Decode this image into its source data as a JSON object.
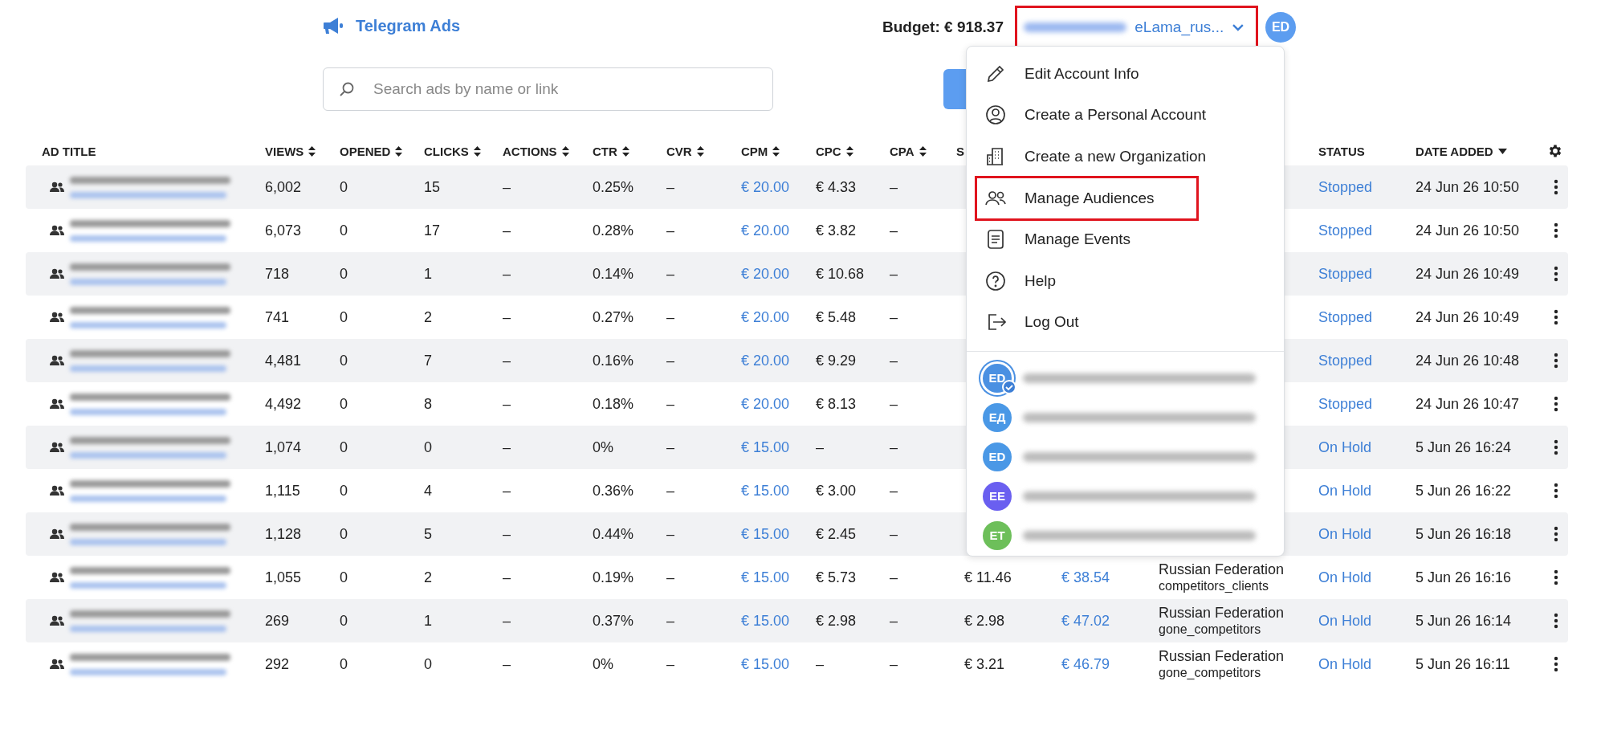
{
  "header": {
    "app_name": "Telegram Ads",
    "budget": "Budget: € 918.37",
    "account": "eLama_rus...",
    "avatar": "ED"
  },
  "search": {
    "placeholder": "Search ads by name or link"
  },
  "table": {
    "columns": [
      {
        "label": "AD TITLE",
        "kind": "plain"
      },
      {
        "label": "VIEWS",
        "kind": "sortable"
      },
      {
        "label": "OPENED",
        "kind": "sortable"
      },
      {
        "label": "CLICKS",
        "kind": "sortable"
      },
      {
        "label": "ACTIONS",
        "kind": "sortable"
      },
      {
        "label": "CTR",
        "kind": "sortable"
      },
      {
        "label": "CVR",
        "kind": "sortable"
      },
      {
        "label": "CPM",
        "kind": "sortable"
      },
      {
        "label": "CPC",
        "kind": "sortable"
      },
      {
        "label": "CPA",
        "kind": "sortable"
      },
      {
        "label": "S",
        "kind": "plain"
      },
      {
        "label": "STATUS",
        "kind": "plain"
      },
      {
        "label": "DATE ADDED",
        "kind": "sorted_desc"
      }
    ],
    "rows": [
      {
        "views": "6,002",
        "opened": "0",
        "clicks": "15",
        "actions": "–",
        "ctr": "0.25%",
        "cvr": "–",
        "cpm": "€ 20.00",
        "cpc": "€ 4.33",
        "cpa": "–",
        "status": "Stopped",
        "date": "24 Jun 26 10:50"
      },
      {
        "views": "6,073",
        "opened": "0",
        "clicks": "17",
        "actions": "–",
        "ctr": "0.28%",
        "cvr": "–",
        "cpm": "€ 20.00",
        "cpc": "€ 3.82",
        "cpa": "–",
        "status": "Stopped",
        "date": "24 Jun 26 10:50"
      },
      {
        "views": "718",
        "opened": "0",
        "clicks": "1",
        "actions": "–",
        "ctr": "0.14%",
        "cvr": "–",
        "cpm": "€ 20.00",
        "cpc": "€ 10.68",
        "cpa": "–",
        "status": "Stopped",
        "date": "24 Jun 26 10:49"
      },
      {
        "views": "741",
        "opened": "0",
        "clicks": "2",
        "actions": "–",
        "ctr": "0.27%",
        "cvr": "–",
        "cpm": "€ 20.00",
        "cpc": "€ 5.48",
        "cpa": "–",
        "status": "Stopped",
        "date": "24 Jun 26 10:49"
      },
      {
        "views": "4,481",
        "opened": "0",
        "clicks": "7",
        "actions": "–",
        "ctr": "0.16%",
        "cvr": "–",
        "cpm": "€ 20.00",
        "cpc": "€ 9.29",
        "cpa": "–",
        "status": "Stopped",
        "date": "24 Jun 26 10:48"
      },
      {
        "views": "4,492",
        "opened": "0",
        "clicks": "8",
        "actions": "–",
        "ctr": "0.18%",
        "cvr": "–",
        "cpm": "€ 20.00",
        "cpc": "€ 8.13",
        "cpa": "–",
        "status": "Stopped",
        "date": "24 Jun 26 10:47"
      },
      {
        "views": "1,074",
        "opened": "0",
        "clicks": "0",
        "actions": "–",
        "ctr": "0%",
        "cvr": "–",
        "cpm": "€ 15.00",
        "cpc": "–",
        "cpa": "–",
        "status": "On Hold",
        "date": "5 Jun 26 16:24"
      },
      {
        "views": "1,115",
        "opened": "0",
        "clicks": "4",
        "actions": "–",
        "ctr": "0.36%",
        "cvr": "–",
        "cpm": "€ 15.00",
        "cpc": "€ 3.00",
        "cpa": "–",
        "status": "On Hold",
        "date": "5 Jun 26 16:22"
      },
      {
        "views": "1,128",
        "opened": "0",
        "clicks": "5",
        "actions": "–",
        "ctr": "0.44%",
        "cvr": "–",
        "cpm": "€ 15.00",
        "cpc": "€ 2.45",
        "cpa": "–",
        "status": "On Hold",
        "date": "5 Jun 26 16:18"
      },
      {
        "views": "1,055",
        "opened": "0",
        "clicks": "2",
        "actions": "–",
        "ctr": "0.19%",
        "cvr": "–",
        "cpm": "€ 15.00",
        "cpc": "€ 5.73",
        "cpa": "–",
        "spent": "€ 11.46",
        "column_12": "€ 38.54",
        "region": "Russian Federation",
        "audience": "competitors_clients",
        "status": "On Hold",
        "date": "5 Jun 26 16:16"
      },
      {
        "views": "269",
        "opened": "0",
        "clicks": "1",
        "actions": "–",
        "ctr": "0.37%",
        "cvr": "–",
        "cpm": "€ 15.00",
        "cpc": "€ 2.98",
        "cpa": "–",
        "spent": "€ 2.98",
        "column_12": "€ 47.02",
        "region": "Russian Federation",
        "audience": "gone_competitors",
        "status": "On Hold",
        "date": "5 Jun 26 16:14"
      },
      {
        "views": "292",
        "opened": "0",
        "clicks": "0",
        "actions": "–",
        "ctr": "0%",
        "cvr": "–",
        "cpm": "€ 15.00",
        "cpc": "–",
        "cpa": "–",
        "spent": "€ 3.21",
        "column_12": "€ 46.79",
        "region": "Russian Federation",
        "audience": "gone_competitors",
        "status": "On Hold",
        "date": "5 Jun 26 16:11"
      }
    ]
  },
  "account_menu": {
    "items": [
      {
        "label": "Edit Account Info",
        "kind": "pencil"
      },
      {
        "label": "Create a Personal Account",
        "kind": "person"
      },
      {
        "label": "Create a new Organization",
        "kind": "building"
      },
      {
        "label": "Manage Audiences",
        "kind": "people"
      },
      {
        "label": "Manage Events",
        "kind": "list"
      },
      {
        "label": "Help",
        "kind": "help"
      },
      {
        "label": "Log Out",
        "kind": "logout"
      }
    ],
    "accounts": [
      {
        "initials": "ED",
        "color": "#4a90e2",
        "selected": true
      },
      {
        "initials": "ЕД",
        "color": "#4a98e6",
        "selected": false
      },
      {
        "initials": "ED",
        "color": "#4a98e6",
        "selected": false
      },
      {
        "initials": "EE",
        "color": "#6a5ff0",
        "selected": false
      },
      {
        "initials": "ET",
        "color": "#6dbf5a",
        "selected": false
      }
    ]
  }
}
